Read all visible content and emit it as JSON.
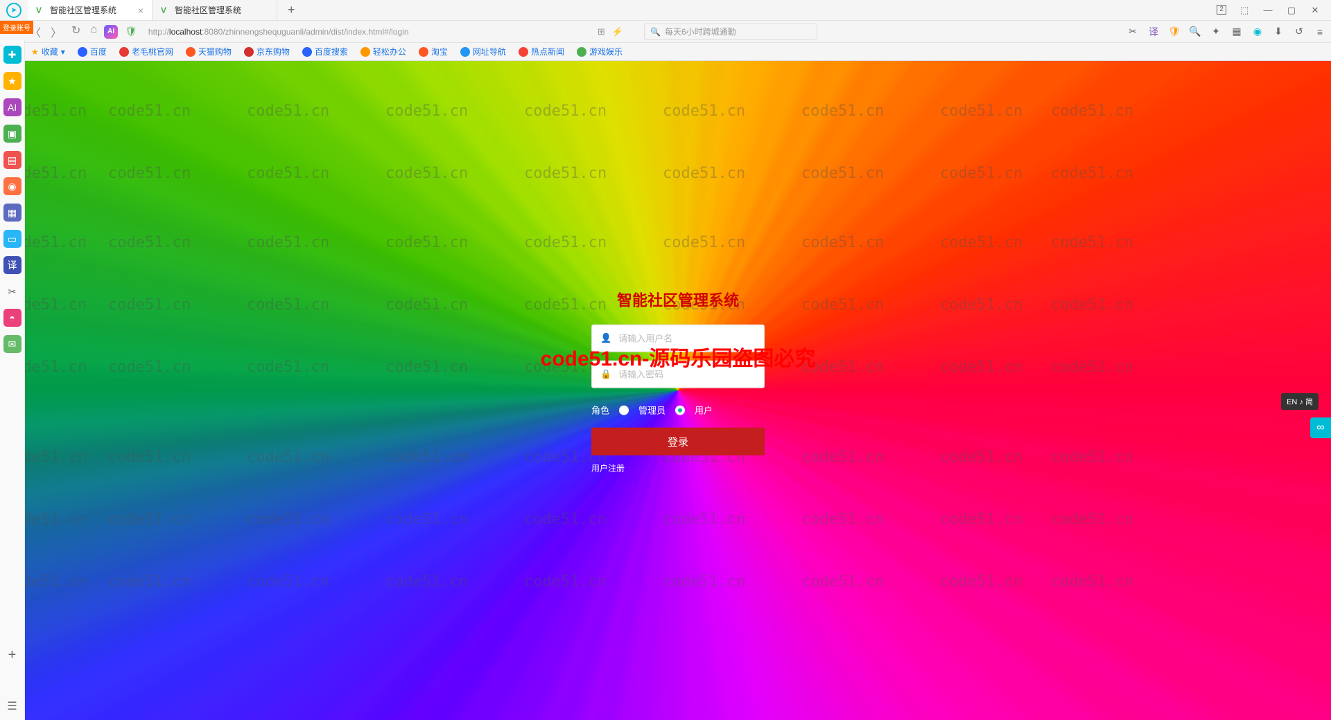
{
  "titlebar": {
    "tabs": [
      {
        "label": "智能社区管理系统",
        "active": true
      },
      {
        "label": "智能社区管理系统",
        "active": false
      }
    ],
    "window_badge": "2"
  },
  "addressbar": {
    "login_tag": "登录账号",
    "url_prefix": "http://",
    "url_host": "localhost",
    "url_rest": ":8080/zhinnengshequguanli/admin/dist/index.html#/login",
    "search_placeholder": "每天6小时跨城通勤"
  },
  "bookmarks": [
    {
      "label": "收藏",
      "color": "#ffa500"
    },
    {
      "label": "百度",
      "color": "#2962ff"
    },
    {
      "label": "老毛桃官网",
      "color": "#e53935"
    },
    {
      "label": "天猫购物",
      "color": "#ff5722"
    },
    {
      "label": "京东购物",
      "color": "#d32f2f"
    },
    {
      "label": "百度搜索",
      "color": "#2962ff"
    },
    {
      "label": "轻松办公",
      "color": "#ff9800"
    },
    {
      "label": "淘宝",
      "color": "#ff5722"
    },
    {
      "label": "网址导航",
      "color": "#2196f3"
    },
    {
      "label": "热点新闻",
      "color": "#f44336"
    },
    {
      "label": "游戏娱乐",
      "color": "#4caf50"
    }
  ],
  "sidebar_colors": [
    "#00bcd4",
    "#ffb300",
    "#ab47bc",
    "#4caf50",
    "#ef5350",
    "#ff7043",
    "#5c6bc0",
    "#29b6f6",
    "#3f51b5",
    "#ec407a",
    "#66bb6a",
    "#ffa726",
    "#8d6e63"
  ],
  "login": {
    "title": "智能社区管理系统",
    "username_placeholder": "请输入用户名",
    "password_placeholder": "请输入密码",
    "role_label": "角色",
    "role_admin": "管理员",
    "role_user": "用户",
    "submit": "登录",
    "register": "用户注册"
  },
  "watermark_text": "code51.cn",
  "center_watermark": "code51.cn-源码乐园盗图必究",
  "float": {
    "lang": "EN ♪ 简"
  }
}
